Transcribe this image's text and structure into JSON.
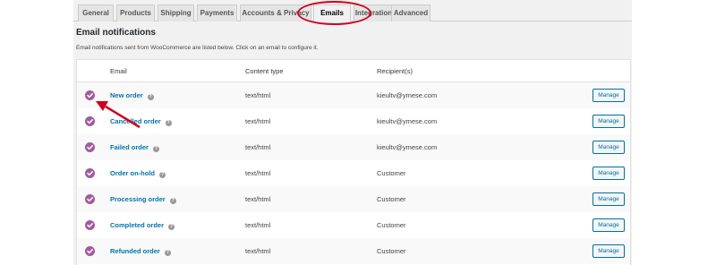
{
  "tabs": [
    {
      "label": "General",
      "active": false
    },
    {
      "label": "Products",
      "active": false
    },
    {
      "label": "Shipping",
      "active": false
    },
    {
      "label": "Payments",
      "active": false
    },
    {
      "label": "Accounts & Privacy",
      "active": false
    },
    {
      "label": "Emails",
      "active": true
    },
    {
      "label": "Integration",
      "active": false
    },
    {
      "label": "Advanced",
      "active": false
    }
  ],
  "section": {
    "title": "Email notifications",
    "description": "Email notifications sent from WooCommerce are listed below. Click on an email to configure it."
  },
  "table": {
    "headers": {
      "email": "Email",
      "content_type": "Content type",
      "recipients": "Recipient(s)"
    },
    "rows": [
      {
        "name": "New order",
        "help": "?",
        "content_type": "text/html",
        "recipient": "kieultv@ymese.com",
        "action": "Manage"
      },
      {
        "name": "Cancelled order",
        "help": "?",
        "content_type": "text/html",
        "recipient": "kieultv@ymese.com",
        "action": "Manage"
      },
      {
        "name": "Failed order",
        "help": "?",
        "content_type": "text/html",
        "recipient": "kieultv@ymese.com",
        "action": "Manage"
      },
      {
        "name": "Order on-hold",
        "help": "?",
        "content_type": "text/html",
        "recipient": "Customer",
        "action": "Manage"
      },
      {
        "name": "Processing order",
        "help": "?",
        "content_type": "text/html",
        "recipient": "Customer",
        "action": "Manage"
      },
      {
        "name": "Completed order",
        "help": "?",
        "content_type": "text/html",
        "recipient": "Customer",
        "action": "Manage"
      },
      {
        "name": "Refunded order",
        "help": "?",
        "content_type": "text/html",
        "recipient": "Customer",
        "action": "Manage"
      }
    ]
  },
  "icons": {
    "enabled": "check-circle-icon",
    "help": "help-icon"
  },
  "colors": {
    "accent": "#a05c9d",
    "link": "#0073aa",
    "annotation": "#d0021b"
  }
}
